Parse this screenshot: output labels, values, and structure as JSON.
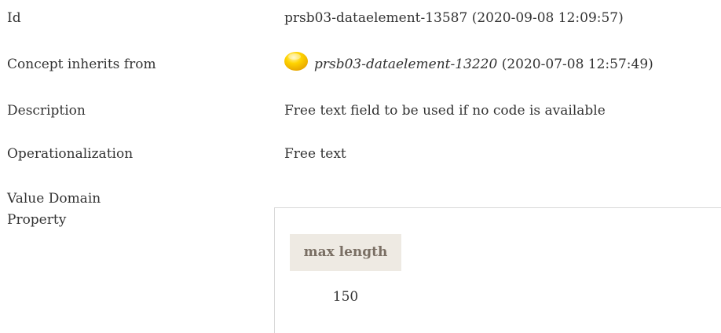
{
  "rows": {
    "id": {
      "label": "Id",
      "value": "prsb03-dataelement-13587 (2020-09-08 12:09:57)"
    },
    "inherits": {
      "label": "Concept inherits from",
      "icon": "yellow-circle-icon",
      "ref_id": "prsb03-dataelement-13220",
      "ref_date": " (2020-07-08 12:57:49)"
    },
    "description": {
      "label": "Description",
      "value": "Free text field to be used if no code is available"
    },
    "operationalization": {
      "label": "Operationalization",
      "value": "Free text"
    },
    "value_domain": {
      "label": "Value Domain"
    },
    "property": {
      "label": "Property",
      "table": {
        "header": "max length",
        "value": "150"
      }
    }
  },
  "colors": {
    "text": "#333333",
    "header_bg": "#eeeae3",
    "header_text": "#7a6f64",
    "icon_fill": "#f5c400",
    "border": "#d9d9d9"
  }
}
